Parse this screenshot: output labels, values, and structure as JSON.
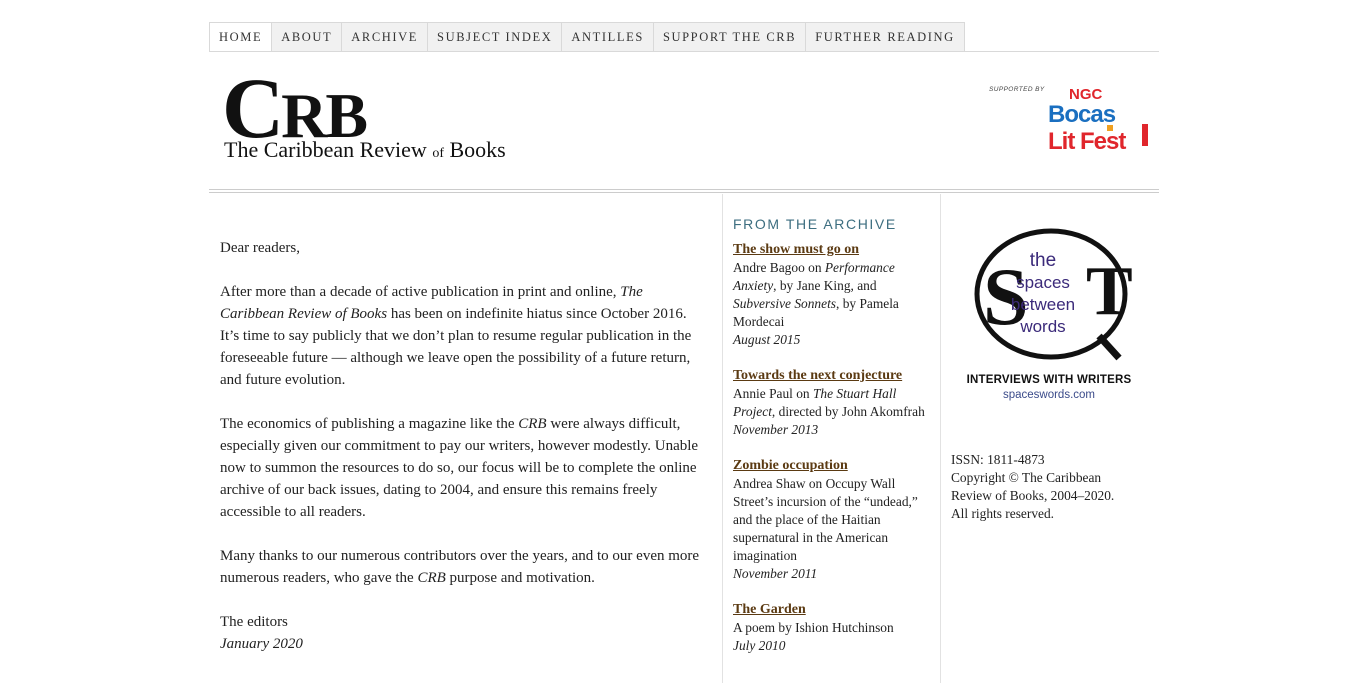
{
  "nav": [
    {
      "label": "HOME",
      "active": true
    },
    {
      "label": "ABOUT",
      "active": false
    },
    {
      "label": "ARCHIVE",
      "active": false
    },
    {
      "label": "SUBJECT INDEX",
      "active": false
    },
    {
      "label": "ANTILLES",
      "active": false
    },
    {
      "label": "SUPPORT THE CRB",
      "active": false
    },
    {
      "label": "FURTHER READING",
      "active": false
    }
  ],
  "masthead": {
    "logo_letter_c": "C",
    "logo_letters_rb": "RB",
    "subtitle_pre": "The Caribbean Review ",
    "subtitle_of": "of",
    "subtitle_post": " Books"
  },
  "sponsor": {
    "label": "SUPPORTED BY",
    "logo_line1": "NGC",
    "logo_line2": "Bocas",
    "logo_line3": "Lit Fest"
  },
  "letter": {
    "greeting": "Dear readers,",
    "p1_a": "After more than a decade of active publication in print and online, ",
    "p1_em": "The Caribbean Review of Books",
    "p1_b": " has been on indefinite hiatus since October 2016. It’s time to say publicly that we don’t plan to resume regular publication in the foreseeable future — although we leave open the possibility of a future return, and future evolution.",
    "p2_a": "The economics of publishing a magazine like the ",
    "p2_em": "CRB",
    "p2_b": " were always difficult, especially given our commitment to pay our writers, however modestly. Unable now to summon the resources to do so, our focus will be to complete the online archive of our back issues, dating to 2004, and ensure this remains freely accessible to all readers.",
    "p3_a": "Many thanks to our numerous contributors over the years, and to our even more numerous readers, who gave the ",
    "p3_em": "CRB",
    "p3_b": " purpose and motivation.",
    "signoff": "The editors",
    "date": "January 2020"
  },
  "archive": {
    "heading": "FROM THE ARCHIVE",
    "items": [
      {
        "title": "The show must go on",
        "d1": "Andre Bagoo on ",
        "d2": "Performance Anxiety",
        "d3": ", by Jane King, and ",
        "d4": "Subversive Sonnets",
        "d5": ", by Pamela Mordecai",
        "date": "August 2015"
      },
      {
        "title": "Towards the next conjecture",
        "d1": "Annie Paul on ",
        "d2": "The Stuart Hall Project",
        "d3": ", directed by John Akomfrah",
        "d4": "",
        "d5": "",
        "date": "November 2013"
      },
      {
        "title": "Zombie occupation",
        "d1": "Andrea Shaw on Occupy Wall Street’s incursion of the “undead,” and the place of the Haitian supernatural in the American imagination",
        "d2": "",
        "d3": "",
        "d4": "",
        "d5": "",
        "date": "November 2011"
      },
      {
        "title": "The Garden",
        "d1": "A poem by Ishion Hutchinson",
        "d2": "",
        "d3": "",
        "d4": "",
        "d5": "",
        "date": "July 2010"
      }
    ]
  },
  "spaces": {
    "line1": "the",
    "line2": "spaces",
    "line3": "between",
    "line4": "words",
    "caption": "INTERVIEWS WITH WRITERS",
    "url": "spaceswords.com"
  },
  "colophon": {
    "issn": "ISSN: 1811-4873",
    "copyright": "Copyright © The Caribbean Review of Books, 2004–2020.",
    "rights": "All rights reserved."
  },
  "colors": {
    "archive_heading": "#3d6e80",
    "archive_link": "#5b3a12",
    "bocas_blue": "#1a6fc0",
    "bocas_red": "#e0262c",
    "bocas_orange": "#f0a020"
  }
}
